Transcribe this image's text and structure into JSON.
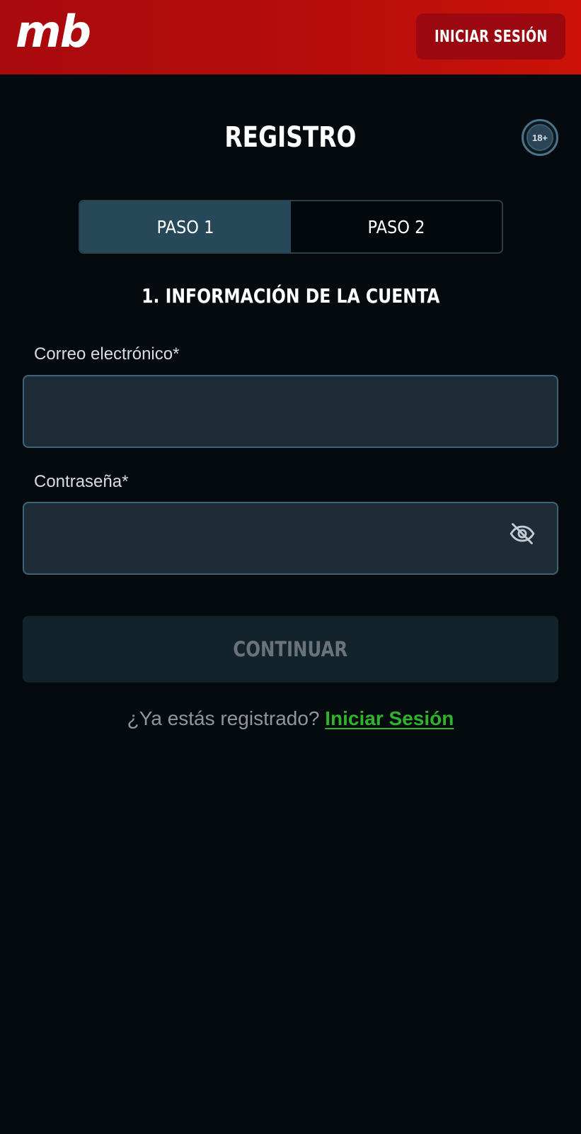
{
  "header": {
    "logo_text": "mb",
    "login_button": "INICIAR SESIÓN"
  },
  "title": "REGISTRO",
  "age_badge": "18+",
  "steps": [
    {
      "label": "PASO 1",
      "active": true
    },
    {
      "label": "PASO 2",
      "active": false
    }
  ],
  "section_title": "1. INFORMACIÓN DE LA CUENTA",
  "form": {
    "email": {
      "label": "Correo electrónico*",
      "value": "",
      "placeholder": ""
    },
    "password": {
      "label": "Contraseña*",
      "value": "",
      "placeholder": "",
      "visibility_icon": "eye-off-icon"
    }
  },
  "continue_button": "CONTINUAR",
  "footer": {
    "question": "¿Ya estás registrado?",
    "link": "Iniciar Sesión"
  },
  "colors": {
    "header_red": "#b60d0b",
    "background": "#050a0f",
    "active_step": "#264859",
    "input_bg": "#1d2c37",
    "link_green": "#2fb32c"
  }
}
